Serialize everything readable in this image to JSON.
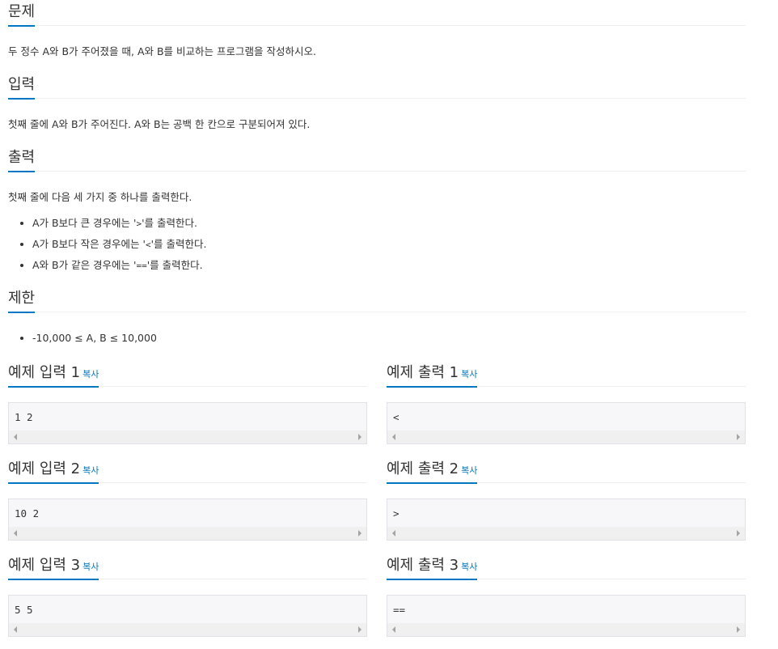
{
  "problem": {
    "title": "문제",
    "description": "두 정수 A와 B가 주어졌을 때, A와 B를 비교하는 프로그램을 작성하시오."
  },
  "input": {
    "title": "입력",
    "description": "첫째 줄에 A와 B가 주어진다. A와 B는 공백 한 칸으로 구분되어져 있다."
  },
  "output": {
    "title": "출력",
    "description": "첫째 줄에 다음 세 가지 중 하나를 출력한다.",
    "items": [
      {
        "pre": "A가 B보다 큰 경우에는 '",
        "op": ">",
        "post": "'를 출력한다."
      },
      {
        "pre": "A가 B보다 작은 경우에는 '",
        "op": "<",
        "post": "'를 출력한다."
      },
      {
        "pre": "A와 B가 같은 경우에는 '",
        "op": "==",
        "post": "'를 출력한다."
      }
    ]
  },
  "limit": {
    "title": "제한",
    "items": [
      "-10,000 ≤ A, B ≤ 10,000"
    ]
  },
  "copy_label": "복사",
  "samples": [
    {
      "input_title": "예제 입력 1",
      "input": "1 2",
      "output_title": "예제 출력 1",
      "output": "<"
    },
    {
      "input_title": "예제 입력 2",
      "input": "10 2",
      "output_title": "예제 출력 2",
      "output": ">"
    },
    {
      "input_title": "예제 입력 3",
      "input": "5 5",
      "output_title": "예제 출력 3",
      "output": "=="
    }
  ],
  "colors": {
    "accent": "#0076c0",
    "text": "#333333",
    "code_bg": "#f7f7f9",
    "code_border": "#e1e1e8"
  }
}
